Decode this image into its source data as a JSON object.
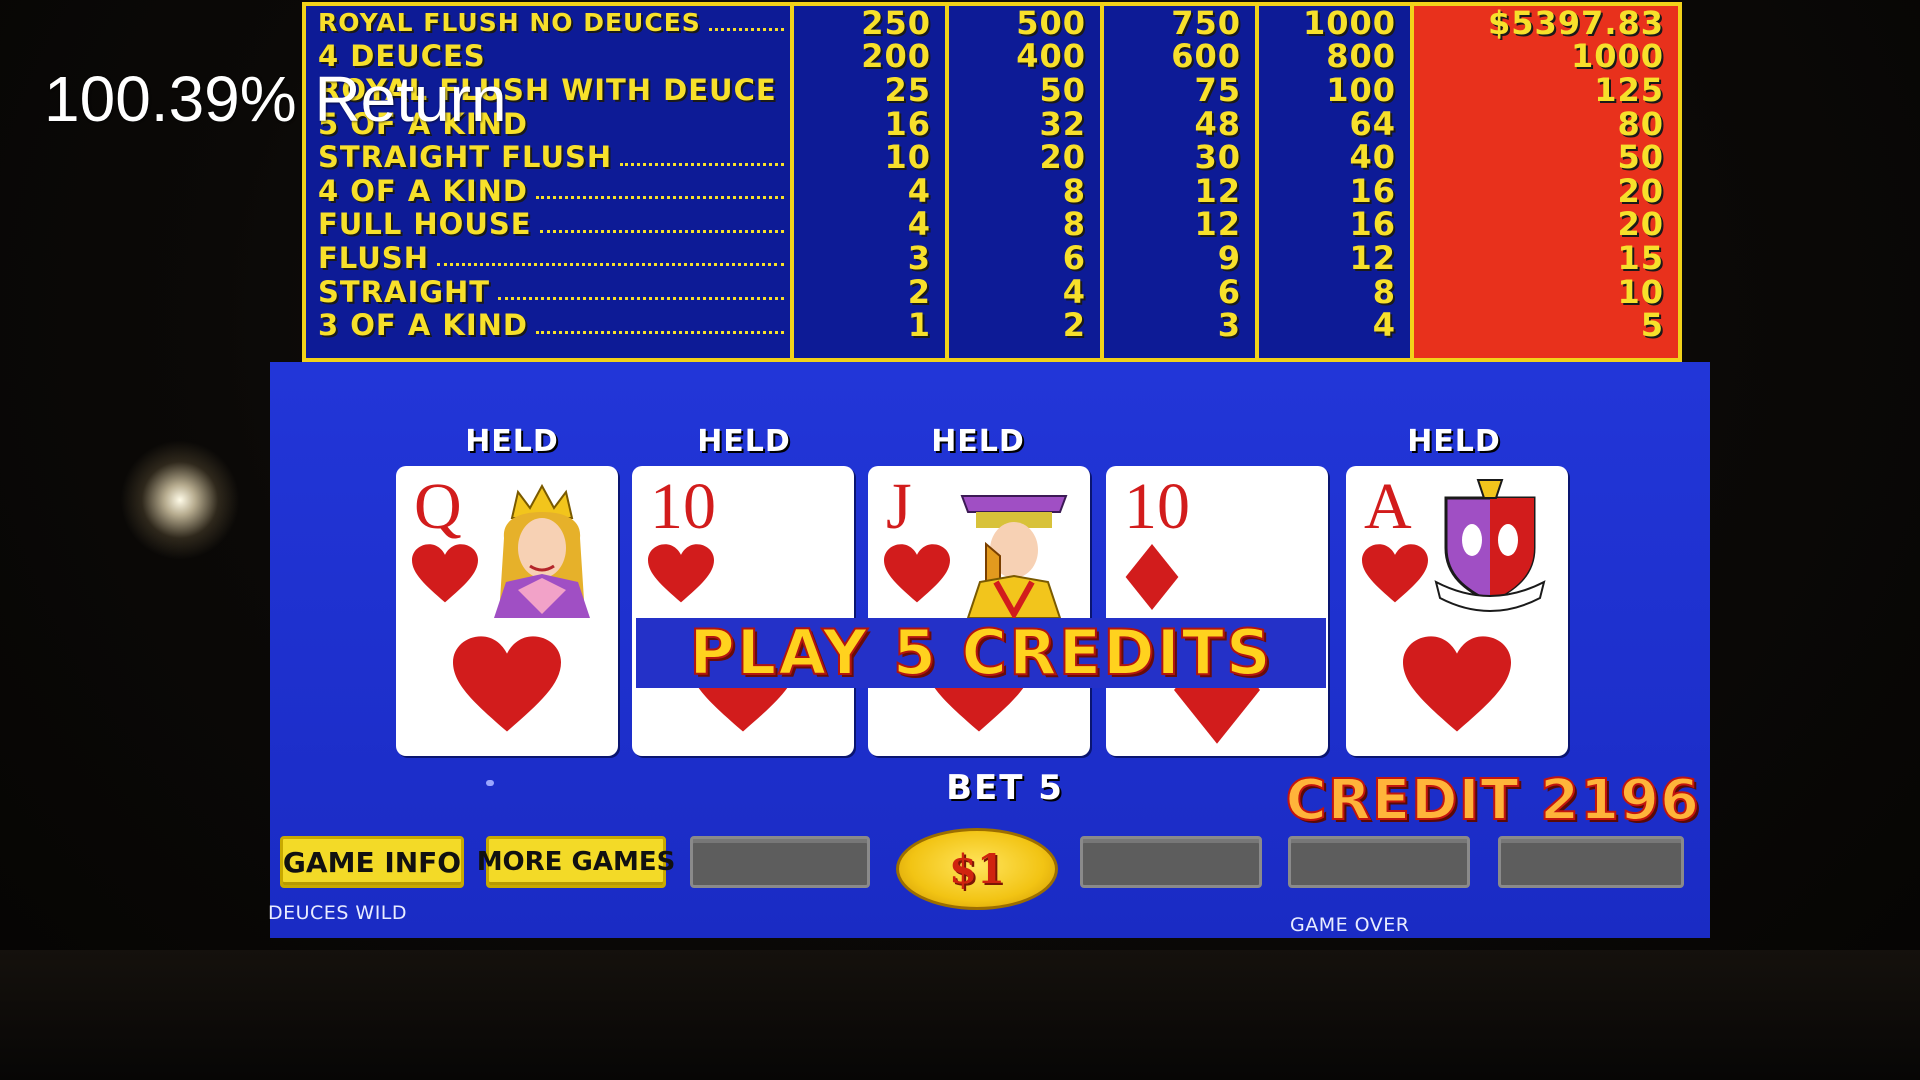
{
  "overlay": {
    "return_text": "100.39% Return"
  },
  "paytable": {
    "hands": [
      "ROYAL FLUSH NO DEUCES",
      "4 DEUCES",
      "ROYAL FLUSH WITH DEUCE",
      "5 OF A KIND",
      "STRAIGHT FLUSH",
      "4 OF A KIND",
      "FULL HOUSE",
      "FLUSH",
      "STRAIGHT",
      "3 OF A KIND"
    ],
    "coin1": [
      "250",
      "200",
      "25",
      "16",
      "10",
      "4",
      "4",
      "3",
      "2",
      "1"
    ],
    "coin2": [
      "500",
      "400",
      "50",
      "32",
      "20",
      "8",
      "8",
      "6",
      "4",
      "2"
    ],
    "coin3": [
      "750",
      "600",
      "75",
      "48",
      "30",
      "12",
      "12",
      "9",
      "6",
      "3"
    ],
    "coin4": [
      "1000",
      "800",
      "100",
      "64",
      "40",
      "16",
      "16",
      "12",
      "8",
      "4"
    ],
    "coin5": [
      "$5397.83",
      "1000",
      "125",
      "80",
      "50",
      "20",
      "20",
      "15",
      "10",
      "5"
    ]
  },
  "cards": [
    {
      "rank": "Q",
      "suit": "hearts",
      "held": "HELD",
      "face": "queen"
    },
    {
      "rank": "10",
      "suit": "hearts",
      "held": "HELD",
      "face": ""
    },
    {
      "rank": "J",
      "suit": "hearts",
      "held": "HELD",
      "face": "jack"
    },
    {
      "rank": "10",
      "suit": "diamonds",
      "held": "",
      "face": ""
    },
    {
      "rank": "A",
      "suit": "hearts",
      "held": "HELD",
      "face": "shield"
    }
  ],
  "banner": "PLAY 5 CREDITS",
  "bet": "BET 5",
  "credit": "CREDIT 2196",
  "buttons": {
    "game_info": "GAME INFO",
    "more_games": "MORE GAMES",
    "denomination": "$1"
  },
  "labels": {
    "game_name": "DEUCES WILD",
    "status": "GAME OVER"
  },
  "colors": {
    "paytable_bg": "#0d1b96",
    "paytable_text": "#f7e02b",
    "highlight_column": "#e8311c",
    "game_bg": "#1f33d4",
    "card_red": "#d21c1c"
  }
}
